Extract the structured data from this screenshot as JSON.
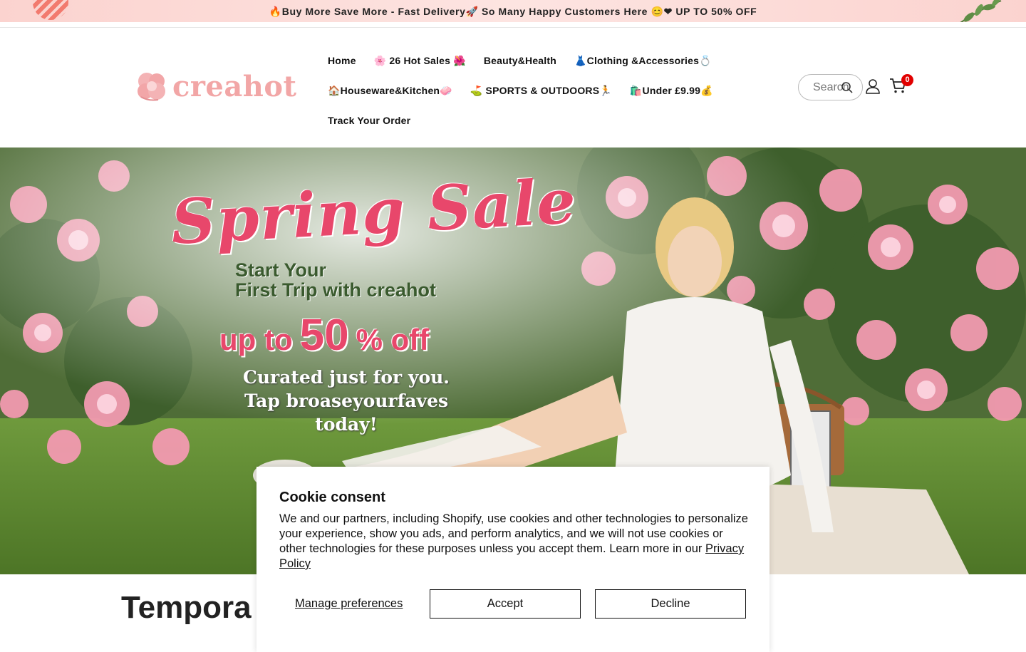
{
  "announcement": {
    "text": "🔥Buy More Save More - Fast Delivery🚀 So Many Happy Customers Here 😊❤ UP TO 50% OFF"
  },
  "logo": {
    "text": "creahot",
    "color": "#f2a6a6"
  },
  "nav": {
    "row1": [
      "Home",
      "🌸 26 Hot Sales 🌺",
      "Beauty&Health",
      "👗Clothing &Accessories💍"
    ],
    "row2": [
      "🏠Houseware&Kitchen🧼",
      "⛳ SPORTS & OUTDOORS🏃",
      "🛍️Under £9.99💰"
    ],
    "row3": [
      "Track Your Order"
    ]
  },
  "search": {
    "placeholder": "Search",
    "icon": "search-icon"
  },
  "account": {
    "icon": "user-icon"
  },
  "cart": {
    "icon": "cart-icon",
    "count": "0",
    "badge_color": "#e10000"
  },
  "hero": {
    "title": "Spring Sale",
    "subtitle_line1": "Start Your",
    "subtitle_line2": "First Trip with creahot",
    "offer_prefix": "up to",
    "offer_number": "50",
    "offer_suffix": "% off",
    "tagline_line1": "Curated just for you.",
    "tagline_line2": "Tap broaseyourfaves today!",
    "accent_color": "#e8476b"
  },
  "section": {
    "heading_visible": "Tempora"
  },
  "cookie": {
    "title": "Cookie consent",
    "body": "We and our partners, including Shopify, use cookies and other technologies to personalize your experience, show you ads, and perform analytics, and we will not use cookies or other technologies for these purposes unless you accept them. Learn more in our ",
    "policy_link": "Privacy Policy",
    "manage_label": "Manage preferences",
    "accept_label": "Accept",
    "decline_label": "Decline"
  }
}
